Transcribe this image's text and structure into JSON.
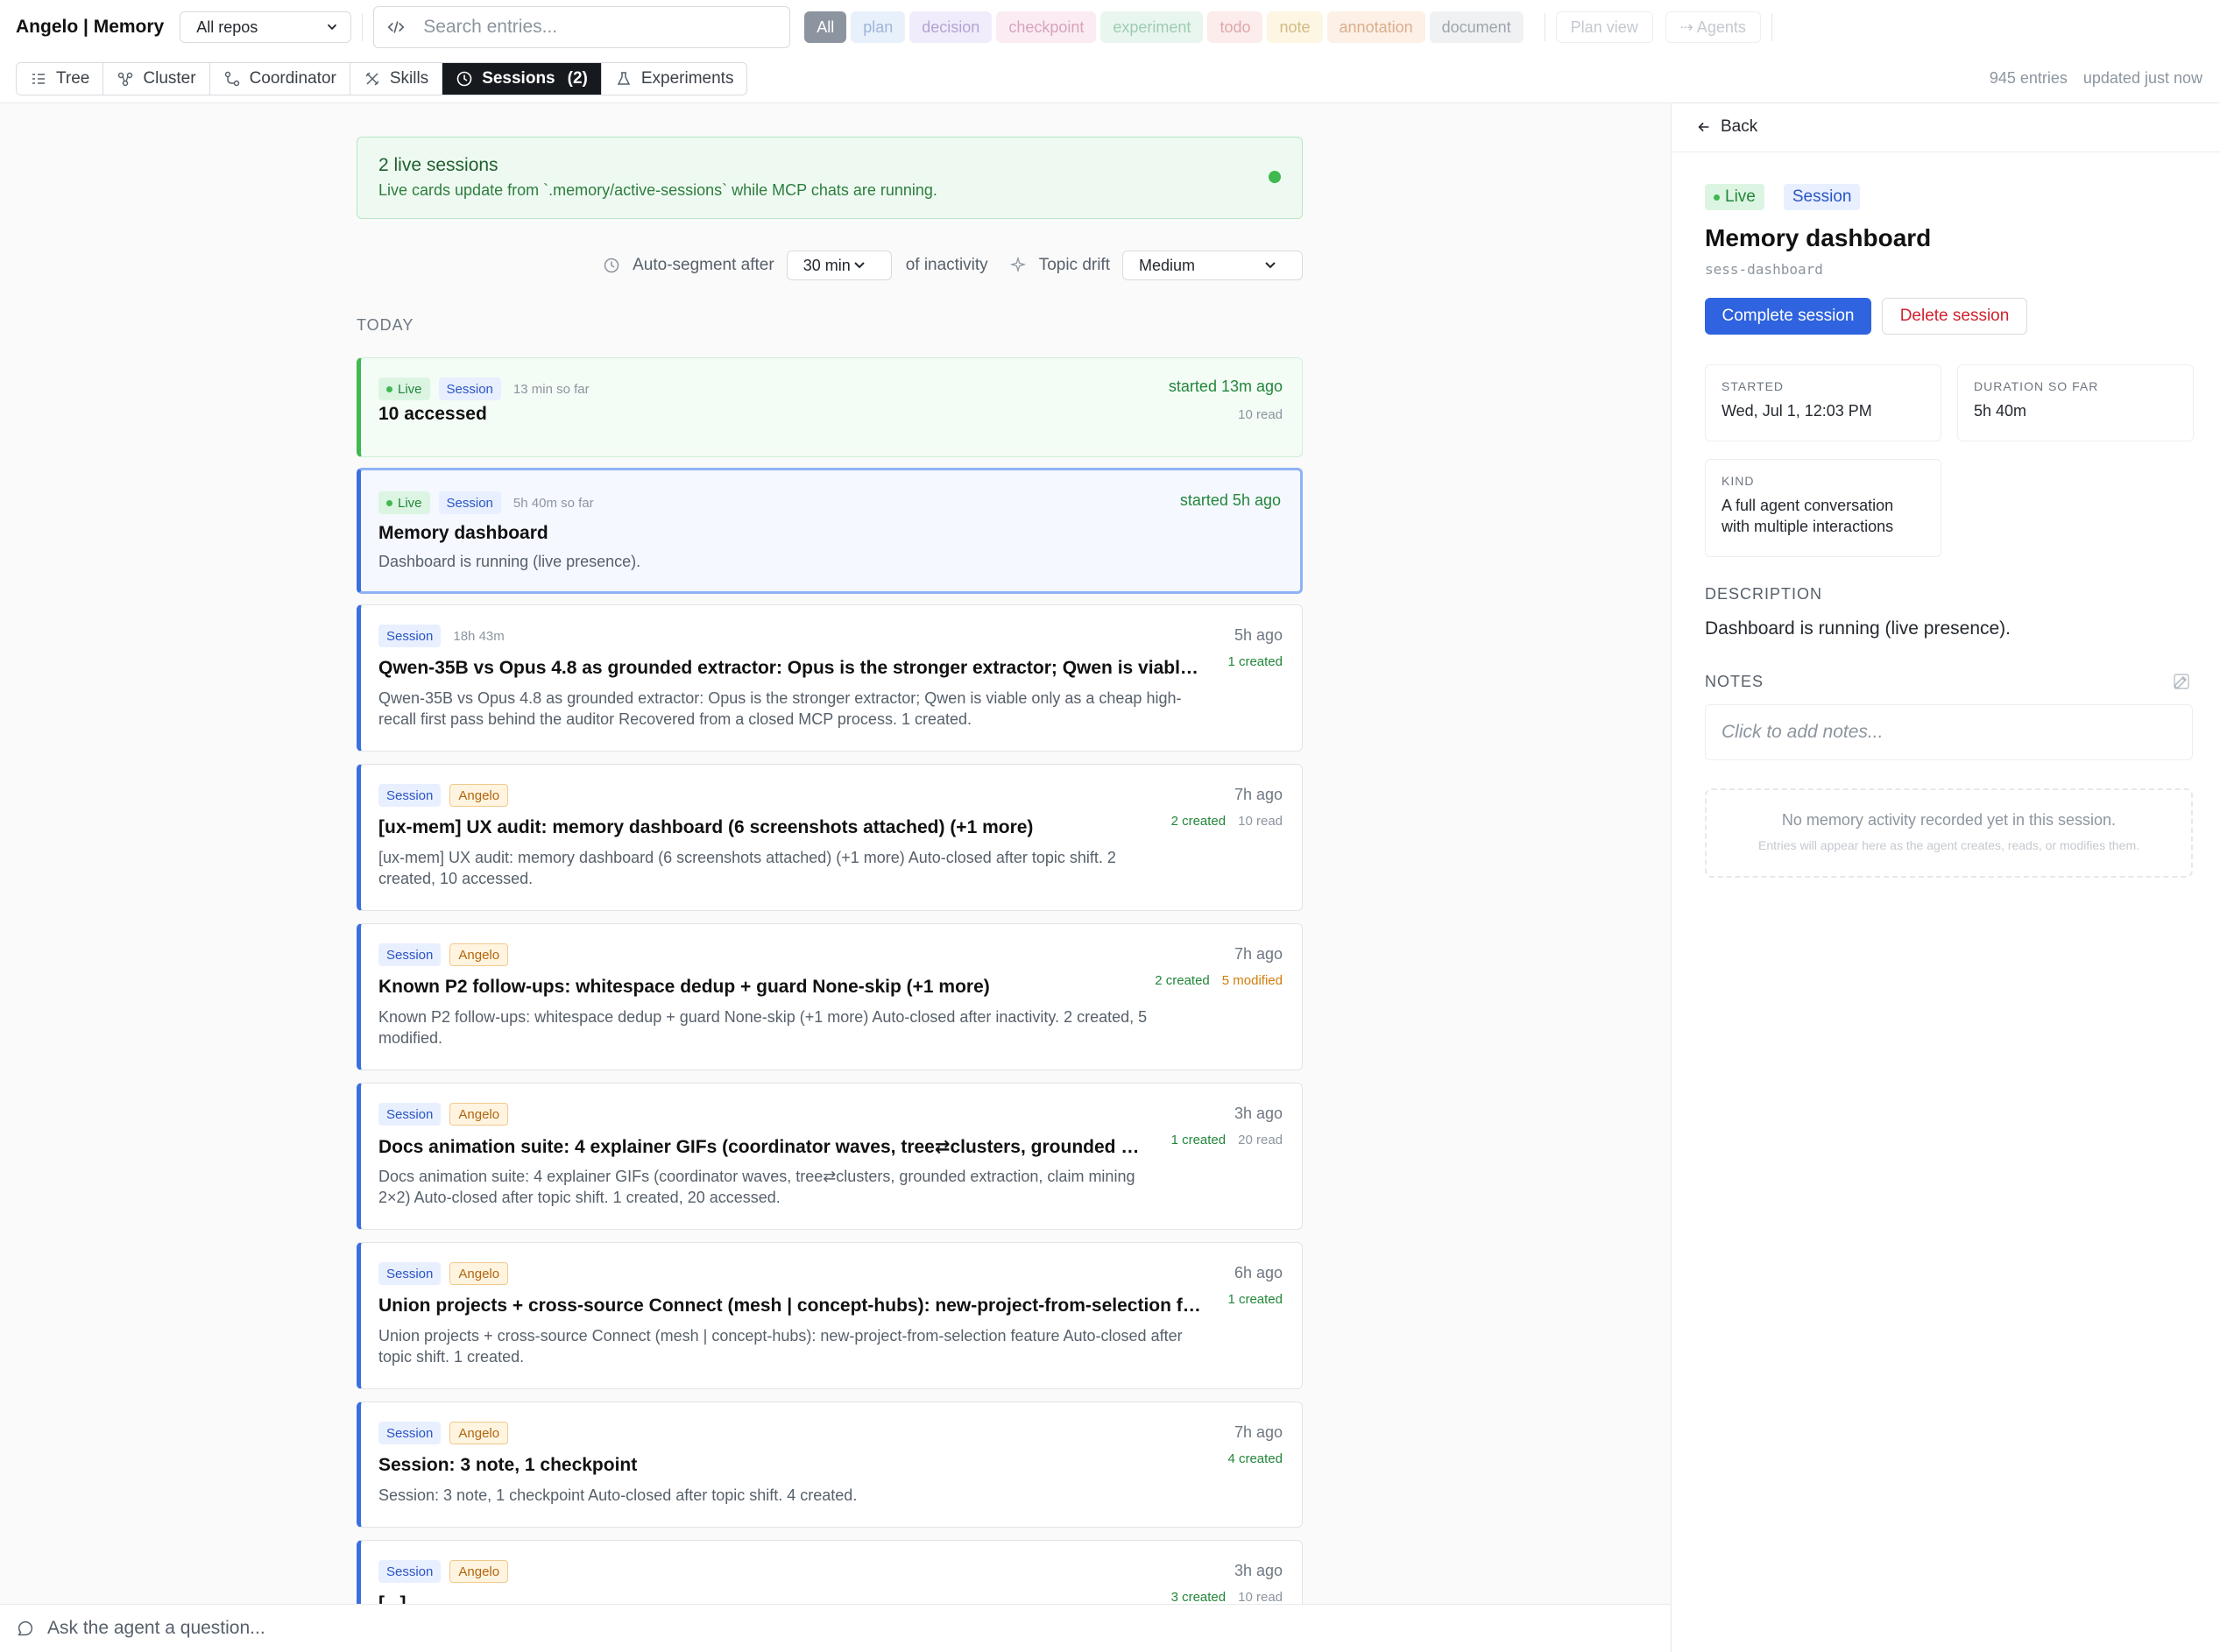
{
  "app": {
    "title": "Angelo | Memory"
  },
  "repo_select": {
    "value": "All repos"
  },
  "search": {
    "placeholder": "Search entries..."
  },
  "filters": [
    {
      "label": "All",
      "bg": "#8c959f",
      "fg": "#ffffff"
    },
    {
      "label": "plan",
      "bg": "#e8f0fb",
      "fg": "#9db6d9"
    },
    {
      "label": "decision",
      "bg": "#f1ecfb",
      "fg": "#b3a3d3"
    },
    {
      "label": "checkpoint",
      "bg": "#fbecf3",
      "fg": "#d7a3bb"
    },
    {
      "label": "experiment",
      "bg": "#e8f6ef",
      "fg": "#9fcbb3"
    },
    {
      "label": "todo",
      "bg": "#fcecec",
      "fg": "#dda8a8"
    },
    {
      "label": "note",
      "bg": "#fdf6e2",
      "fg": "#d2bb83"
    },
    {
      "label": "annotation",
      "bg": "#fdf0e6",
      "fg": "#d9ae8d"
    },
    {
      "label": "document",
      "bg": "#f0f1f3",
      "fg": "#9ea4ab"
    }
  ],
  "top_buttons": {
    "plan_view": "Plan view",
    "agents": "⇢ Agents"
  },
  "tabs": [
    {
      "label": "Tree",
      "icon": "tree-icon"
    },
    {
      "label": "Cluster",
      "icon": "cluster-icon"
    },
    {
      "label": "Coordinator",
      "icon": "coordinator-icon"
    },
    {
      "label": "Skills",
      "icon": "skills-icon"
    },
    {
      "label": "Sessions",
      "icon": "clock-icon",
      "count": "(2)",
      "active": true
    },
    {
      "label": "Experiments",
      "icon": "flask-icon"
    }
  ],
  "nav_meta": {
    "entries": "945 entries",
    "updated": "updated just now"
  },
  "live_banner": {
    "title": "2 live sessions",
    "subtitle": "Live cards update from `.memory/active-sessions` while MCP chats are running."
  },
  "controls": {
    "auto_segment_label": "Auto-segment after",
    "minutes_value": "30 min",
    "inactivity_label": "of inactivity",
    "topic_drift_label": "Topic drift",
    "drift_value": "Medium"
  },
  "section_label": "TODAY",
  "sessions": [
    {
      "live": "Live",
      "kind": "Session",
      "meta": "13 min so far",
      "title": "10 accessed",
      "time": "started 13m ago",
      "read": "10 read"
    },
    {
      "live": "Live",
      "kind": "Session",
      "meta": "5h 40m so far",
      "title": "Memory dashboard",
      "desc": "Dashboard is running (live presence).",
      "time": "started 5h ago"
    },
    {
      "kind": "Session",
      "meta": "18h 43m",
      "title": "Qwen-35B vs Opus 4.8 as grounded extractor: Opus is the stronger extractor; Qwen is viable only as a cheap high-recall first pass behind the auditor",
      "desc": "Qwen-35B vs Opus 4.8 as grounded extractor: Opus is the stronger extractor; Qwen is viable only as a cheap high-recall first pass behind the auditor Recovered from a closed MCP process. 1 created.",
      "time": "5h ago",
      "created": "1 created"
    },
    {
      "kind": "Session",
      "user": "Angelo",
      "title": "[ux-mem] UX audit: memory dashboard (6 screenshots attached) (+1 more)",
      "desc": "[ux-mem] UX audit: memory dashboard (6 screenshots attached) (+1 more) Auto-closed after topic shift. 2 created, 10 accessed.",
      "time": "7h ago",
      "created": "2 created",
      "read": "10 read"
    },
    {
      "kind": "Session",
      "user": "Angelo",
      "title": "Known P2 follow-ups: whitespace dedup + guard None-skip (+1 more)",
      "desc": "Known P2 follow-ups: whitespace dedup + guard None-skip (+1 more) Auto-closed after inactivity. 2 created, 5 modified.",
      "time": "7h ago",
      "created": "2 created",
      "modified": "5 modified"
    },
    {
      "kind": "Session",
      "user": "Angelo",
      "title": "Docs animation suite: 4 explainer GIFs (coordinator waves, tree⇄clusters, grounded extraction, claim mining 2×2)",
      "desc": "Docs animation suite: 4 explainer GIFs (coordinator waves, tree⇄clusters, grounded extraction, claim mining 2×2) Auto-closed after topic shift. 1 created, 20 accessed.",
      "time": "3h ago",
      "created": "1 created",
      "read": "20 read"
    },
    {
      "kind": "Session",
      "user": "Angelo",
      "title": "Union projects + cross-source Connect (mesh | concept-hubs): new-project-from-selection feature",
      "desc": "Union projects + cross-source Connect (mesh | concept-hubs): new-project-from-selection feature Auto-closed after topic shift. 1 created.",
      "time": "6h ago",
      "created": "1 created"
    },
    {
      "kind": "Session",
      "user": "Angelo",
      "title": "Session: 3 note, 1 checkpoint",
      "desc": "Session: 3 note, 1 checkpoint Auto-closed after topic shift. 4 created.",
      "time": "7h ago",
      "created": "4 created"
    },
    {
      "kind": "Session",
      "user": "Angelo",
      "title": "[...]",
      "time": "3h ago",
      "created": "3 created",
      "read": "10 read"
    }
  ],
  "panel": {
    "back": "Back",
    "live_badge": "Live",
    "kind_badge": "Session",
    "title": "Memory dashboard",
    "id": "sess-dashboard",
    "complete_btn": "Complete session",
    "delete_btn": "Delete session",
    "started_label": "STARTED",
    "started_value": "Wed, Jul 1, 12:03 PM",
    "duration_label": "DURATION SO FAR",
    "duration_value": "5h 40m",
    "kind_label": "KIND",
    "kind_value": "A full agent conversation with multiple interactions",
    "description_label": "DESCRIPTION",
    "description": "Dashboard is running (live presence).",
    "notes_label": "NOTES",
    "notes_placeholder": "Click to add notes...",
    "empty_title": "No memory activity recorded yet in this session.",
    "empty_sub": "Entries will appear here as the agent creates, reads, or modifies them."
  },
  "ask": {
    "placeholder": "Ask the agent a question..."
  }
}
